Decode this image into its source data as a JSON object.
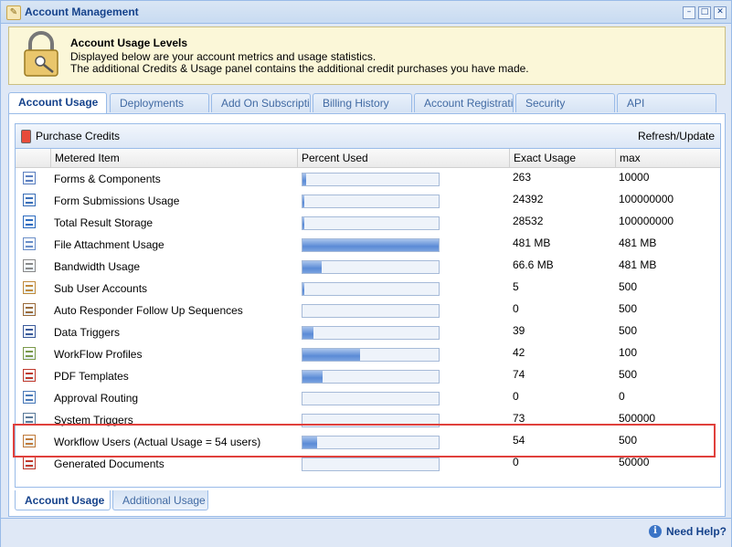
{
  "window": {
    "title": "Account Management"
  },
  "banner": {
    "title": "Account Usage Levels",
    "line1": "Displayed below are your account metrics and usage statistics.",
    "line2": "The additional Credits & Usage panel contains the additional credit purchases you have made."
  },
  "tabs": [
    "Account Usage",
    "Deployments",
    "Add On Subscriptio",
    "Billing History",
    "Account Registrati",
    "Security",
    "API"
  ],
  "toolbar": {
    "purchase": "Purchase Credits",
    "refresh": "Refresh/Update"
  },
  "columns": [
    "Metered Item",
    "Percent Used",
    "Exact Usage",
    "max"
  ],
  "rows": [
    {
      "name": "Forms & Components",
      "exact": "263",
      "max": "10000",
      "percent": 0.03,
      "icon": "form-icon"
    },
    {
      "name": "Form Submissions Usage",
      "exact": "24392",
      "max": "100000000",
      "percent": 0.0,
      "icon": "submission-icon"
    },
    {
      "name": "Total Result Storage",
      "exact": "28532",
      "max": "100000000",
      "percent": 0.0,
      "icon": "storage-icon"
    },
    {
      "name": "File Attachment Usage",
      "exact": "481 MB",
      "max": "481 MB",
      "percent": 1.0,
      "icon": "attachment-icon"
    },
    {
      "name": "Bandwidth Usage",
      "exact": "66.6 MB",
      "max": "481 MB",
      "percent": 0.14,
      "icon": "bandwidth-icon"
    },
    {
      "name": "Sub User Accounts",
      "exact": "5",
      "max": "500",
      "percent": 0.01,
      "icon": "users-icon"
    },
    {
      "name": "Auto Responder Follow Up Sequences",
      "exact": "0",
      "max": "500",
      "percent": 0.0,
      "icon": "autoresponder-icon"
    },
    {
      "name": "Data Triggers",
      "exact": "39",
      "max": "500",
      "percent": 0.08,
      "icon": "trigger-icon"
    },
    {
      "name": "WorkFlow Profiles",
      "exact": "42",
      "max": "100",
      "percent": 0.42,
      "icon": "workflow-icon"
    },
    {
      "name": "PDF Templates",
      "exact": "74",
      "max": "500",
      "percent": 0.15,
      "icon": "pdf-icon"
    },
    {
      "name": "Approval Routing",
      "exact": "0",
      "max": "0",
      "percent": 0.0,
      "icon": "routing-icon"
    },
    {
      "name": "System Triggers",
      "exact": "73",
      "max": "500000",
      "percent": 0.0,
      "icon": "system-trigger-icon"
    },
    {
      "name": "Workflow Users (Actual Usage = 54 users)",
      "exact": "54",
      "max": "500",
      "percent": 0.11,
      "icon": "workflow-user-icon"
    },
    {
      "name": "Generated Documents",
      "exact": "0",
      "max": "50000",
      "percent": 0.0,
      "icon": "document-icon"
    }
  ],
  "bottom_tabs": [
    "Account Usage",
    "Additional Usage"
  ],
  "footer": {
    "help": "Need Help?"
  }
}
